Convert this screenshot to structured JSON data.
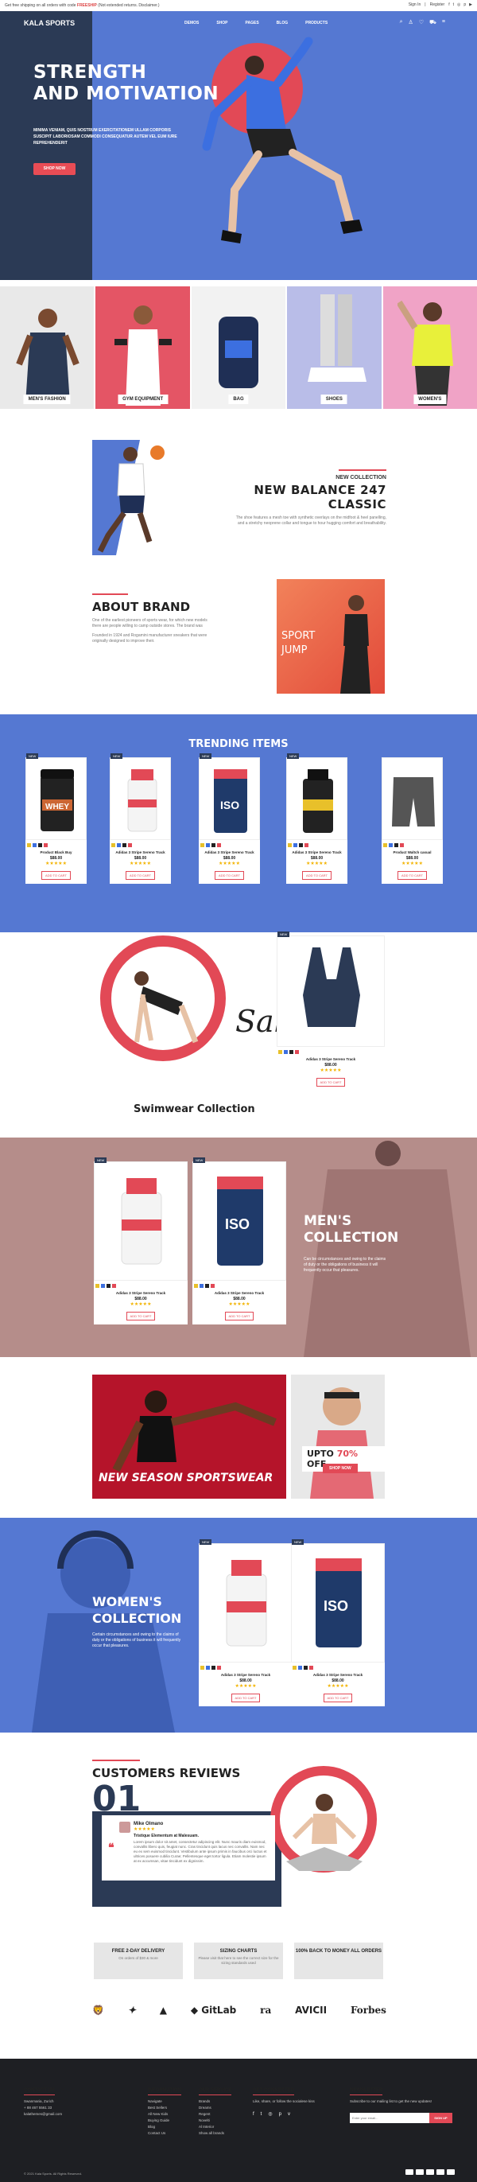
{
  "topbar": {
    "message": "Get free shipping on all orders with code",
    "code": "FREESHIP",
    "message_end": "(Not extended returns. Disclaimer.)",
    "sign_in": "Sign In",
    "register": "Register"
  },
  "nav": {
    "logo": "KALA SPORTS",
    "items": [
      "DEMOS",
      "SHOP",
      "PAGES",
      "BLOG",
      "PRODUCTS"
    ]
  },
  "hero": {
    "title_line1": "STRENGTH",
    "title_line2": "AND MOTIVATION",
    "subtitle": "MINIMA VENIAM, QUIS NOSTRUM EXERCITATIONEM ULLAM CORPORIS SUSCIPIT LABORIOSAM COMMODI CONSEQUATUR AUTEM VEL EUM IURE REPREHENDERIT",
    "cta": "SHOP NOW"
  },
  "categories": [
    {
      "label": "MEN'S FASHION"
    },
    {
      "label": "GYM EQUIPMENT"
    },
    {
      "label": "BAG"
    },
    {
      "label": "SHOES"
    },
    {
      "label": "WOMEN'S"
    }
  ],
  "new_collection": {
    "label": "NEW COLLECTION",
    "title": "NEW BALANCE 247 CLASSIC",
    "text": "The shoe features a mesh toe with synthetic overlays on the midfoot & heel panelling, and a stretchy neoprene collar and tongue to hour hugging comfort and breathability."
  },
  "about": {
    "title": "ABOUT BRAND",
    "text1": "One of the earliest pioneers of sports wear, for which new models there are people willing to camp outside stores. The brand was",
    "text2": "Founded in 1924 and Rogamini manufacturer sneakers that were originally designed to improve their.",
    "banner_line1": "SPORT",
    "banner_line2": "JUMP"
  },
  "trending": {
    "title": "TRENDING ITEMS",
    "products": [
      {
        "name": "Product Black Buy",
        "price": "$88.00",
        "button": "ADD TO CART"
      },
      {
        "name": "Adidas 3 Stripe Sereno Track",
        "price": "$88.00",
        "button": "ADD TO CART"
      },
      {
        "name": "Adidas 3 Stripe Sereno Track",
        "price": "$88.00",
        "button": "ADD TO CART"
      },
      {
        "name": "Adidas 3 Stripe Sereno Track",
        "price": "$88.00",
        "button": "ADD TO CART"
      },
      {
        "name": "Product Waltch casual",
        "price": "$88.00",
        "button": "ADD TO CART"
      }
    ],
    "new_badge": "NEW"
  },
  "swimwear": {
    "title": "Swimwear Collection",
    "sale": "Sale",
    "product": {
      "name": "Adidas 3 Stripe Sereno Track",
      "price": "$88.00",
      "button": "ADD TO CART"
    }
  },
  "mens": {
    "title_line1": "MEN'S",
    "title_line2": "COLLECTION",
    "text": "Can be circumstances and owing to the claims of duty or the obligations of business it will frequently occur that pleasures.",
    "products": [
      {
        "name": "Adidas 3 Stripe Sereno Track",
        "price": "$88.00",
        "button": "ADD TO CART"
      },
      {
        "name": "Adidas 3 Stripe Sereno Track",
        "price": "$88.00",
        "button": "ADD TO CART"
      }
    ]
  },
  "promo": {
    "new_season": "NEW SEASON SPORTSWEAR",
    "upto": "UPTO",
    "percent": "70%",
    "off": "OFF",
    "shop": "SHOP NOW"
  },
  "womens": {
    "title_line1": "WOMEN'S",
    "title_line2": "COLLECTION",
    "text": "Certain circumstances and owing to the claims of duty or the obligations of business it will frequently occur that pleasures.",
    "products": [
      {
        "name": "Adidas 3 Stripe Sereno Track",
        "price": "$88.00",
        "button": "ADD TO CART"
      },
      {
        "name": "Adidas 3 Stripe Sereno Track",
        "price": "$88.00",
        "button": "ADD TO CART"
      }
    ]
  },
  "reviews": {
    "title": "CUSTOMERS REVIEWS",
    "number": "01",
    "name": "Mike Olmano",
    "stars": "★★★★★",
    "headline": "Tristique Elementum at Malesuam.",
    "text": "Lorem ipsum dolor sit amet, consectetur adipiscing elit. Nunc mauris diam euismod, convallis libero quis, feugiat nunc. Cras tincidunt quis lacus nec convallis. Nam nec eu ex sem euismod tincidunt. Vestibulum ante ipsum primis in faucibus orci luctus et ultrices posuere cubilia Curae; Pellentesque eget tortor ligula. Etiam molestie ipsum at ex accumsan, vitae tincidunt ex dignissim."
  },
  "features": [
    {
      "title": "FREE 2-DAY DELIVERY",
      "desc": "On orders of $30 & more"
    },
    {
      "title": "SIZING CHARTS",
      "desc": "Please visit that here to see the correct size for the sizing standards used"
    },
    {
      "title": "100% BACK TO MONEY ALL ORDERS",
      "desc": ""
    }
  ],
  "brands": [
    "GitLab",
    "AVICII",
    "Forbes"
  ],
  "footer": {
    "contact_title": "CONTACT US",
    "contact": [
      "Swanmaria, Zurich",
      "+ 88 467 5561 33",
      "kalathemes@gmail.com"
    ],
    "info_title": "INFORMATION",
    "info": [
      "Navigate",
      "Best Sellers",
      "All New Kids",
      "Buying Guide",
      "Blog",
      "Contact Us"
    ],
    "service_title": "OUR SERVICE",
    "service": [
      "Brands",
      "Dreams",
      "Regent",
      "Novelti",
      "Al Interior",
      "Show all brands"
    ],
    "connect_title": "GET CONNECTED",
    "connect_text": "Like, share, or follow the socialese kiss",
    "news_title": "NEWSLETTER",
    "news_text": "Subscribe to our mailing list to get the new updates!",
    "placeholder": "Enter your email...",
    "subscribe": "SIGN UP",
    "copyright": "© 2021 Kala Sports. All Rights Reserved."
  },
  "colors": {
    "brand_blue": "#5578d2",
    "navy": "#2b3a55",
    "accent": "#e24956",
    "mauve": "#b58d8a"
  }
}
